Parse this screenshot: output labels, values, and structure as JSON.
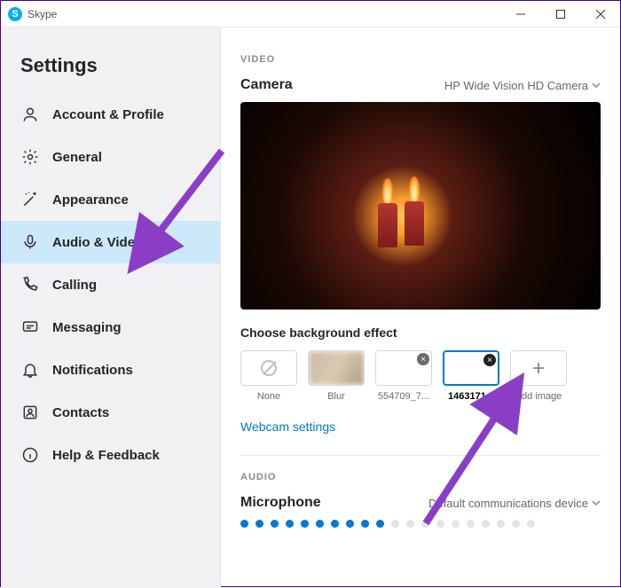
{
  "window": {
    "app_name": "Skype"
  },
  "sidebar": {
    "title": "Settings",
    "items": [
      {
        "label": "Account & Profile"
      },
      {
        "label": "General"
      },
      {
        "label": "Appearance"
      },
      {
        "label": "Audio & Video"
      },
      {
        "label": "Calling"
      },
      {
        "label": "Messaging"
      },
      {
        "label": "Notifications"
      },
      {
        "label": "Contacts"
      },
      {
        "label": "Help & Feedback"
      }
    ],
    "active_index": 3
  },
  "video": {
    "section_label": "VIDEO",
    "camera_label": "Camera",
    "camera_value": "HP Wide Vision HD Camera",
    "bg_effect_label": "Choose background effect",
    "effects": {
      "none": "None",
      "blur": "Blur",
      "img1": "554709_7...",
      "img2": "1463171...",
      "add": "Add image"
    },
    "webcam_link": "Webcam settings"
  },
  "audio": {
    "section_label": "AUDIO",
    "mic_label": "Microphone",
    "mic_value": "Default communications device",
    "level_active": 10,
    "level_total": 20
  }
}
